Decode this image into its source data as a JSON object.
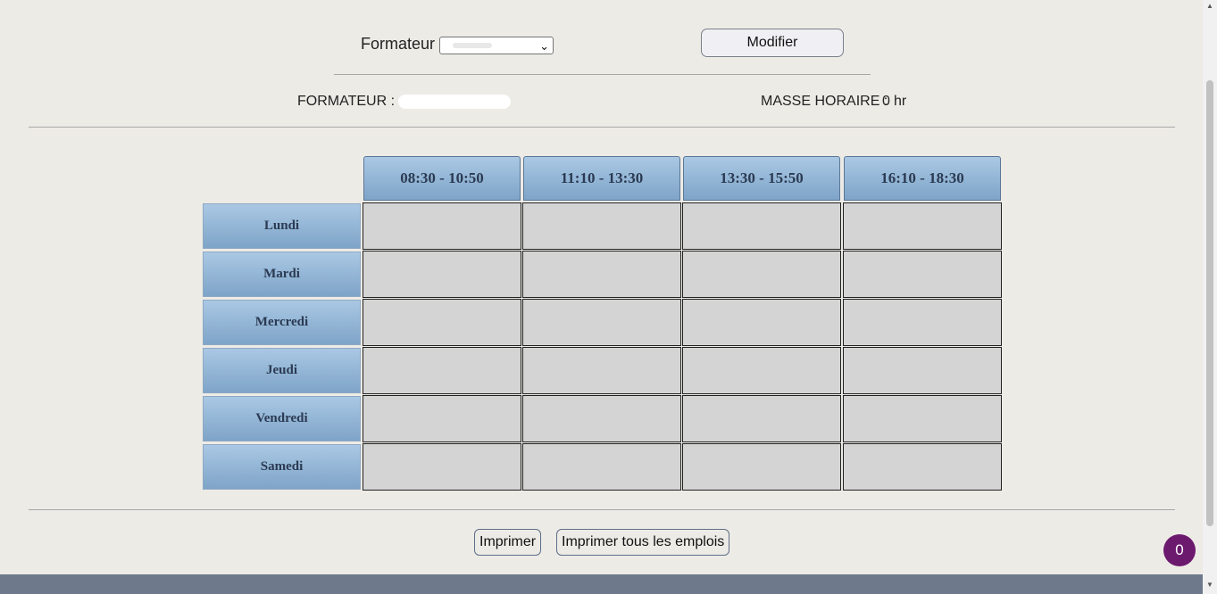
{
  "form": {
    "formateur_label": "Formateur",
    "formateur_select_value": "",
    "modifier_label": "Modifier"
  },
  "info": {
    "formateur_label": "FORMATEUR :",
    "formateur_value": "",
    "masse_label": "MASSE HORAIRE :",
    "masse_value": "0",
    "masse_unit": "hr"
  },
  "schedule": {
    "time_slots": [
      "08:30 - 10:50",
      "11:10 - 13:30",
      "13:30 - 15:50",
      "16:10 - 18:30"
    ],
    "days": [
      "Lundi",
      "Mardi",
      "Mercredi",
      "Jeudi",
      "Vendredi",
      "Samedi"
    ]
  },
  "actions": {
    "print_label": "Imprimer",
    "print_all_label": "Imprimer tous les emplois"
  },
  "badge": {
    "count": "0"
  },
  "colors": {
    "header_gradient_top": "#aac8e4",
    "header_gradient_bottom": "#7ea4c8",
    "cell_bg": "#d4d4d4",
    "badge_bg": "#6c1a6e",
    "footer_bg": "#6e7a8c"
  }
}
